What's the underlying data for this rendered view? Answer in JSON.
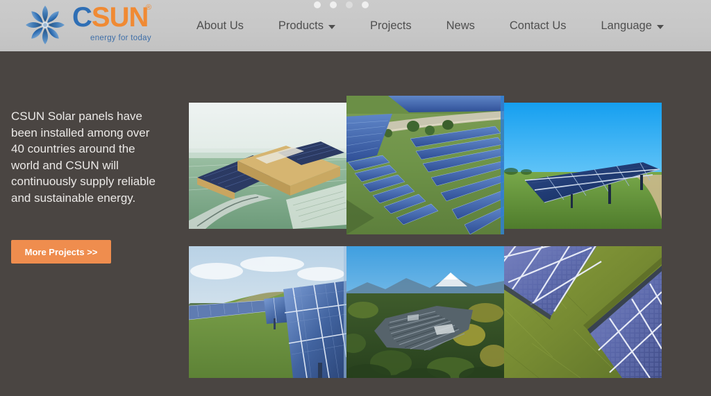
{
  "header": {
    "logo": {
      "mark_name": "csun-sunflower-logo-icon",
      "word_first": "C",
      "word_rest": "SUN",
      "registered": "®",
      "tagline": "energy for today",
      "color_blue": "#2f6fb5",
      "color_orange": "#f08a33"
    },
    "background_color": "#c9c9c9",
    "nav": [
      {
        "label": "About Us",
        "has_dropdown": false
      },
      {
        "label": "Products",
        "has_dropdown": true
      },
      {
        "label": "Projects",
        "has_dropdown": false
      },
      {
        "label": "News",
        "has_dropdown": false
      },
      {
        "label": "Contact Us",
        "has_dropdown": false
      },
      {
        "label": "Language",
        "has_dropdown": true
      }
    ],
    "carousel_dots": {
      "count": 4,
      "active_index": 2
    }
  },
  "hero": {
    "background_color": "#4a4542",
    "paragraph": "CSUN Solar panels have been installed among over 40 countries around the world and CSUN will continuously supply reliable and sustainable energy.",
    "cta_label": "More Projects >>",
    "cta_color": "#ef8d4e"
  },
  "gallery": {
    "images": [
      {
        "name": "solar-rooftop-terminal-building-render",
        "alt": "Architectural rendering of large terminal building with rooftop solar panels"
      },
      {
        "name": "aerial-solar-farm-rows-green-field",
        "alt": "Aerial view of solar farm rows across green fields"
      },
      {
        "name": "ground-mount-solar-array-blue-sky",
        "alt": "Ground mounted solar array under bright blue sky"
      },
      {
        "name": "hillside-solar-panels-cloudy-sky",
        "alt": "Solar panels on green hillside under cloudy sky"
      },
      {
        "name": "aerial-solar-plant-autumn-forest-mountain",
        "alt": "Aerial view of solar plant surrounded by autumn forest with mountain"
      },
      {
        "name": "closeup-aerial-solar-panels-grass",
        "alt": "Close up aerial view of two solar panel rows on grass"
      }
    ]
  }
}
